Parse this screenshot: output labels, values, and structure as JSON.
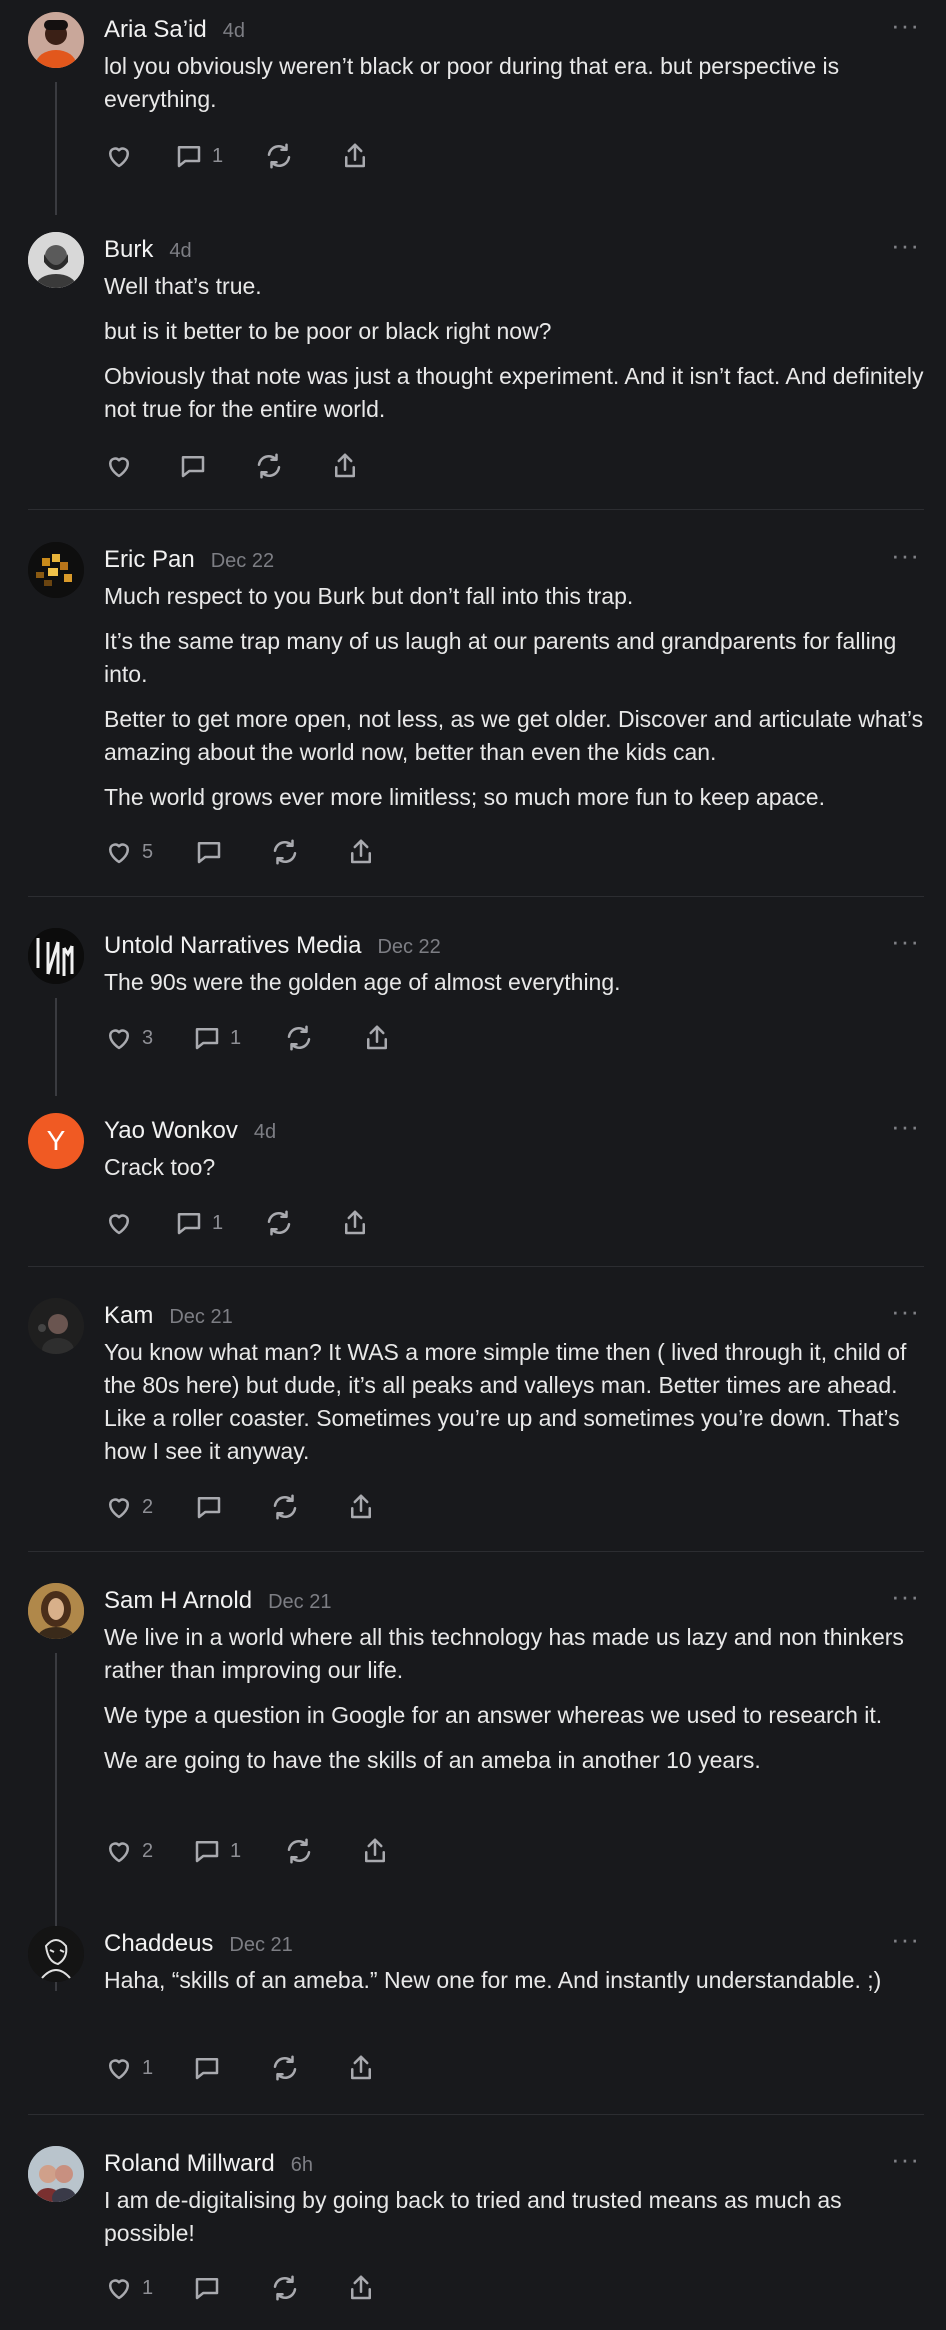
{
  "comments": [
    {
      "name": "Aria Sa’id",
      "date": "4d",
      "paragraphs": [
        "lol you obviously weren’t black or poor during that era. but perspective is everything."
      ],
      "likes": "",
      "replies": "1",
      "avatar_icon": "person-photo"
    },
    {
      "name": "Burk",
      "date": "4d",
      "paragraphs": [
        "Well that’s true.",
        "but is it better to be poor or black right now?",
        "Obviously that note was just a thought experiment. And it isn’t fact. And definitely not true for the entire world."
      ],
      "likes": "",
      "replies": "",
      "avatar_icon": "person-photo"
    },
    {
      "name": "Eric Pan",
      "date": "Dec 22",
      "paragraphs": [
        "Much respect to you Burk but don’t fall into this trap.",
        "It’s the same trap many of us laugh at our parents and grandparents for falling into.",
        "Better to get more open, not less, as we get older. Discover and articulate what’s amazing about the world now, better than even the kids can.",
        "The world grows ever more limitless; so much more fun to keep apace."
      ],
      "likes": "5",
      "replies": "",
      "avatar_icon": "pixel-art"
    },
    {
      "name": "Untold Narratives Media",
      "date": "Dec 22",
      "paragraphs": [
        "The 90s were the golden age of almost everything."
      ],
      "likes": "3",
      "replies": "1",
      "avatar_icon": "unm-logo"
    },
    {
      "name": "Yao Wonkov",
      "date": "4d",
      "paragraphs": [
        "Crack too?"
      ],
      "likes": "",
      "replies": "1",
      "avatar_letter": "Y",
      "avatar_color": "#f05a23"
    },
    {
      "name": "Kam",
      "date": "Dec 21",
      "paragraphs": [
        "You know what man? It WAS a more simple time then ( lived through it, child of the 80s here) but dude, it’s all peaks and valleys man. Better times are ahead. Like a roller coaster. Sometimes you’re up and sometimes you’re down. That’s how I see it anyway."
      ],
      "likes": "2",
      "replies": "",
      "avatar_icon": "person-photo"
    },
    {
      "name": "Sam H Arnold",
      "date": "Dec 21",
      "paragraphs": [
        "We live in a world where all this technology has made us lazy and non thinkers rather than improving our life.",
        "We type a question in Google for an answer whereas we used to research it.",
        "We are going to have the skills of an ameba in another 10 years."
      ],
      "likes": "2",
      "replies": "1",
      "avatar_icon": "person-photo"
    },
    {
      "name": "Chaddeus",
      "date": "Dec 21",
      "paragraphs": [
        "Haha, “skills of an ameba.” New one for me. And instantly understandable. ;)"
      ],
      "likes": "1",
      "replies": "",
      "avatar_icon": "sketch-portrait"
    },
    {
      "name": "Roland Millward",
      "date": "6h",
      "paragraphs": [
        "I am de-digitalising by going back to tried and trusted means as much as possible!"
      ],
      "likes": "1",
      "replies": "",
      "avatar_icon": "person-photo"
    }
  ],
  "more_label": "···"
}
